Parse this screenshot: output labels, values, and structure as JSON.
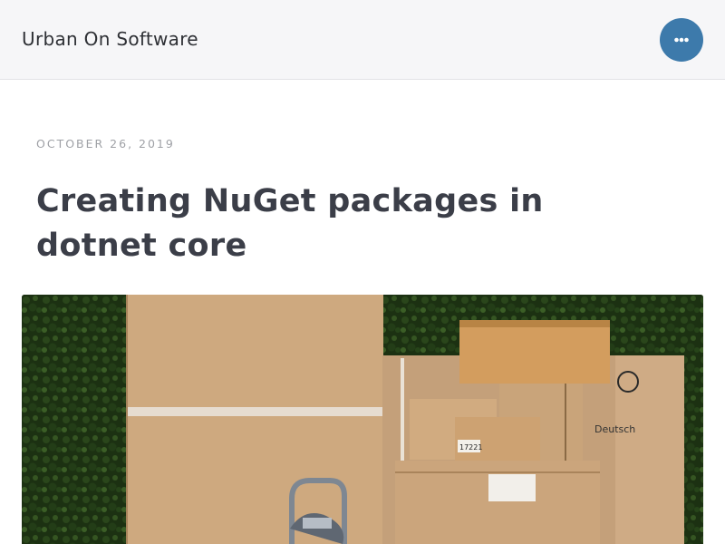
{
  "header": {
    "site_title": "Urban On Software",
    "menu_icon": "more-horizontal-icon",
    "menu_color": "#3d7aab"
  },
  "post": {
    "date": "OCTOBER 26, 2019",
    "title": "Creating NuGet packages in dotnet core"
  },
  "hero": {
    "subject": "cardboard-boxes-photo",
    "box_label_left": "17221",
    "box_label_right": "Deutsch"
  }
}
